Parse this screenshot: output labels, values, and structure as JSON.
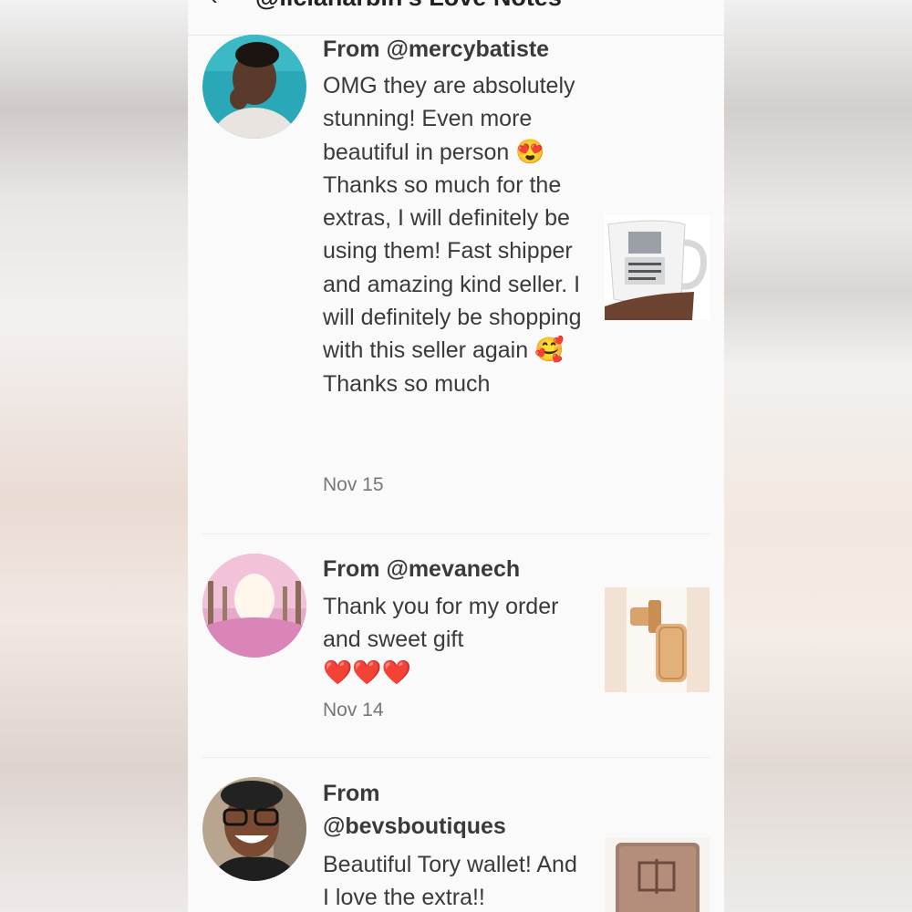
{
  "header": {
    "back_icon": "‹",
    "title": "@liciaharbin's Love Notes"
  },
  "notes": [
    {
      "from": "From @mercybatiste",
      "message_part1": "OMG they are absolutely stunning! Even more beautiful in person ",
      "emoji1": "😍",
      "message_part2": " Thanks so much for the extras, I will definitely be using them! Fast shipper and amazing kind seller. I will definitely be shopping with this seller again ",
      "emoji2": "🥰",
      "message_part3": "Thanks so much",
      "date": "Nov 15",
      "thumb": "mug-photo"
    },
    {
      "from": "From @mevanech",
      "message_part1": "Thank you for my order and sweet gift",
      "emoji1": "❤️❤️❤️",
      "date": "Nov 14",
      "thumb": "luggage-tag-photo"
    },
    {
      "from_line1": "From",
      "from_line2": "@bevsboutiques",
      "message": "Beautiful Tory wallet! And I love the extra!!",
      "thumb": "wallet-photo"
    }
  ]
}
